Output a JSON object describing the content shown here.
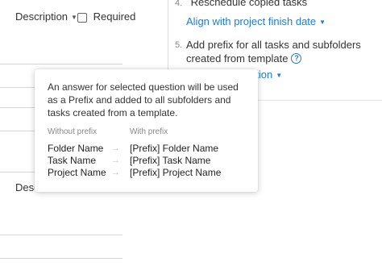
{
  "table": {
    "description_header": "Description",
    "required_header": "Required",
    "description_header_2": "Descr"
  },
  "steps": [
    {
      "number": "4.",
      "text": "Reschedule copied tasks",
      "option": "Align with project finish date"
    },
    {
      "number": "5.",
      "text": "Add prefix for all tasks and subfolders created from template",
      "option": "ation"
    }
  ],
  "tooltip": {
    "description": "An answer for selected question will be used as a Prefix and added to all subfolders and tasks created from a template.",
    "without_header": "Without prefix",
    "with_header": "With prefix",
    "rows": [
      {
        "without": "Folder Name",
        "with": "[Prefix] Folder Name"
      },
      {
        "without": "Task Name",
        "with": "[Prefix] Task Name"
      },
      {
        "without": "Project Name",
        "with": "[Prefix] Project Name"
      }
    ]
  },
  "icons": {
    "caret": "caret-down-icon",
    "info": "info-icon",
    "arrow": "arrow-right-icon"
  },
  "colors": {
    "link": "#1e7bd6",
    "muted": "#888888"
  }
}
